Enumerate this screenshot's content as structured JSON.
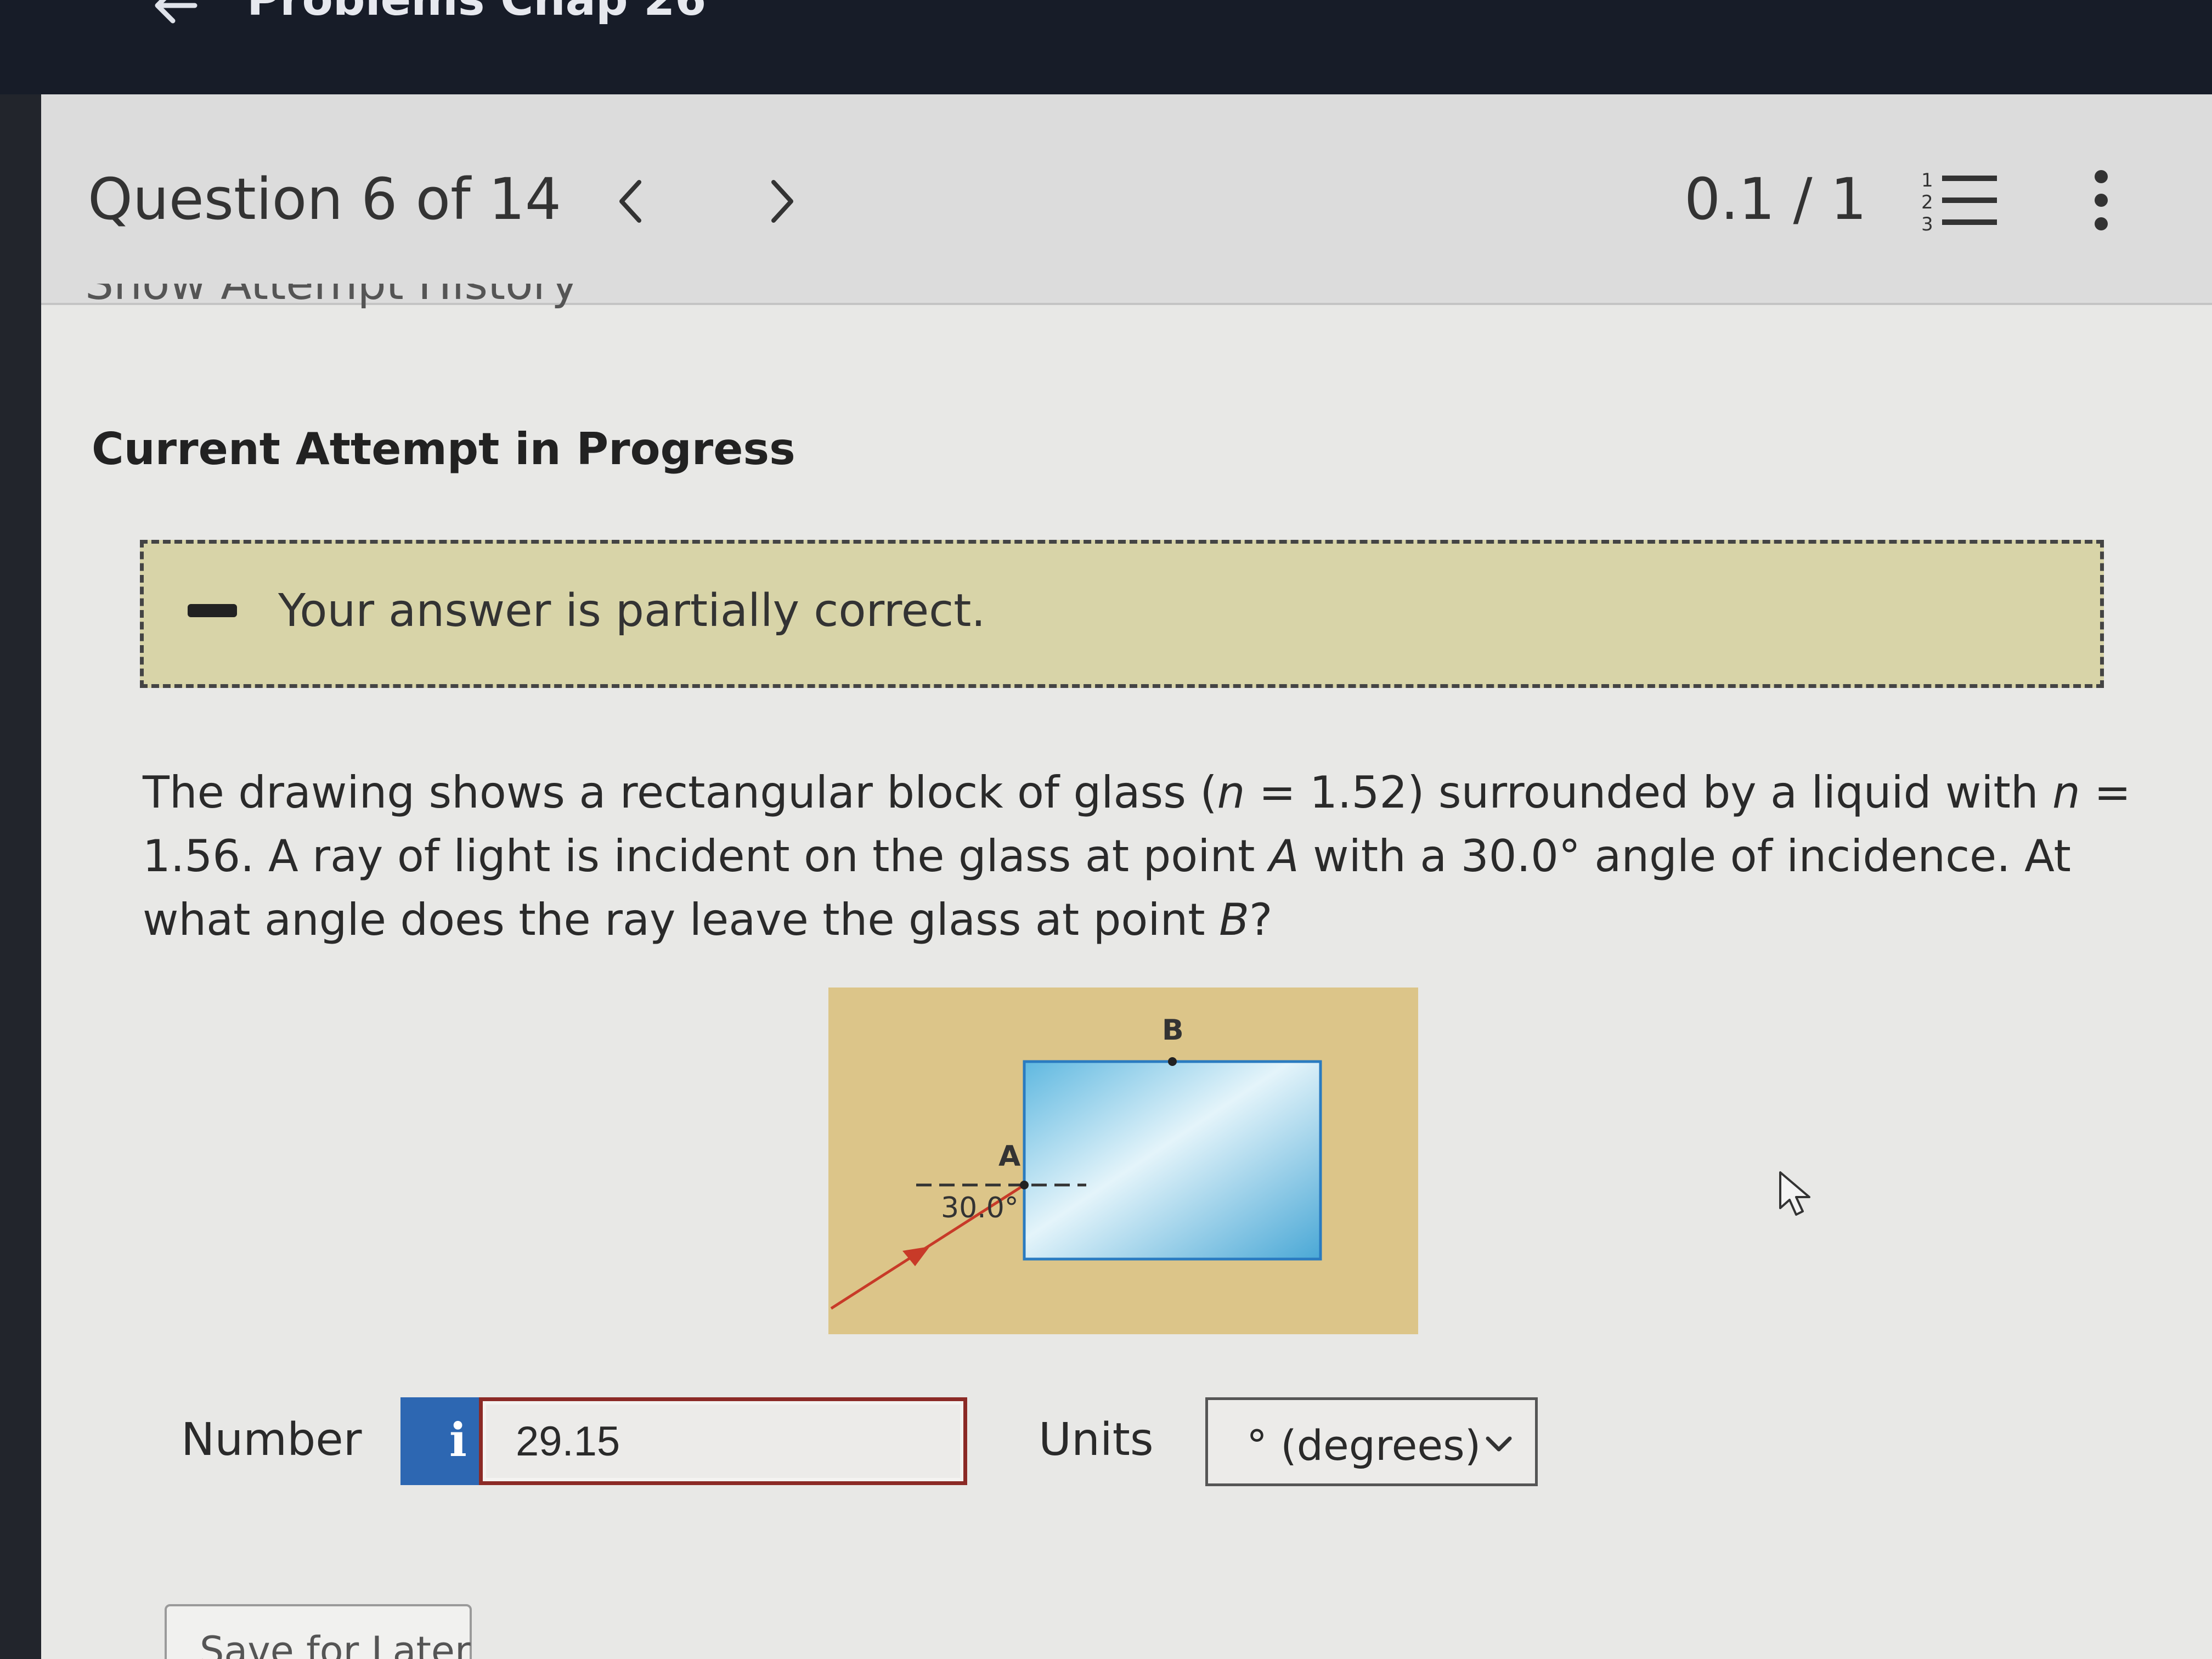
{
  "topbar": {
    "title": "Problems Chap 26"
  },
  "header": {
    "question_count": "Question 6 of 14",
    "score": "0.1 / 1"
  },
  "hidden_link": "Show Attempt History",
  "attempt": {
    "title": "Current Attempt in Progress",
    "feedback": "Your answer is partially correct."
  },
  "question": {
    "part1": "The drawing shows a rectangular block of glass (",
    "n1_var": "n",
    "part2": " = 1.52) surrounded by a liquid with ",
    "n2_var": "n",
    "part3": " = 1.56. A ray of light is incident on the glass at point ",
    "pointA": "A",
    "part4": " with a 30.0° angle of incidence. At what angle does the ray leave the glass at point ",
    "pointB": "B",
    "part5": "?"
  },
  "figure": {
    "angle_label": "30.0°",
    "point_a": "A",
    "point_b": "B",
    "colors": {
      "liquid": "#dcc589",
      "glass": "#8fd0e8",
      "ray": "#c83a28"
    }
  },
  "answer": {
    "number_label": "Number",
    "info_icon": "i",
    "number_value": "29.15",
    "units_label": "Units",
    "units_value": "° (degrees)"
  },
  "save_button": "Save for Later"
}
